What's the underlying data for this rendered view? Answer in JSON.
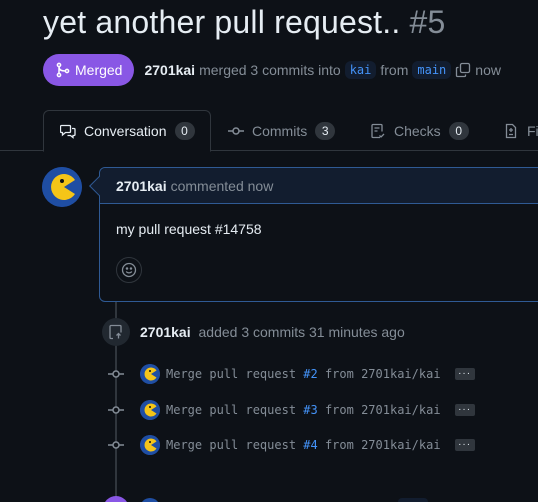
{
  "pr": {
    "title": "yet another pull request..",
    "number": "#5",
    "status": "Merged",
    "author": "2701kai",
    "merge_text": "merged 3 commits into",
    "base_branch": "kai",
    "from_text": "from",
    "head_branch": "main",
    "time": "now"
  },
  "tabs": [
    {
      "label": "Conversation",
      "count": "0"
    },
    {
      "label": "Commits",
      "count": "3"
    },
    {
      "label": "Checks",
      "count": "0"
    },
    {
      "label": "Fi"
    }
  ],
  "comment": {
    "author": "2701kai",
    "action": "commented now",
    "body": "my pull request #14758"
  },
  "event": {
    "author": "2701kai",
    "text": "added 3 commits 31 minutes ago"
  },
  "commits": [
    {
      "prefix": "Merge pull request ",
      "pr": "#2",
      "suffix": " from 2701kai/kai"
    },
    {
      "prefix": "Merge pull request ",
      "pr": "#3",
      "suffix": " from 2701kai/kai"
    },
    {
      "prefix": "Merge pull request ",
      "pr": "#4",
      "suffix": " from 2701kai/kai"
    }
  ],
  "icons": {
    "merge": "git-merge-icon",
    "copy": "copy-icon",
    "conversation": "comment-discussion-icon",
    "commits": "git-commit-icon",
    "checks": "checklist-icon",
    "files": "file-diff-icon",
    "smiley": "smiley-icon",
    "push": "repo-push-icon"
  },
  "colors": {
    "merged": "#8957e5",
    "link": "#4493f8",
    "avatar_bg": "#1f4ea3",
    "avatar_face": "#f5c518"
  }
}
